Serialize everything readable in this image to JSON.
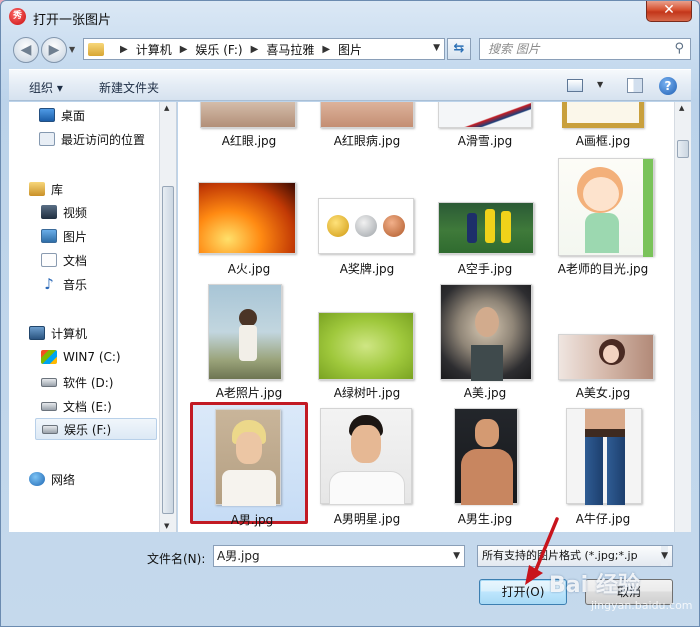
{
  "window": {
    "title": "打开一张图片",
    "app_icon_text": "秀",
    "close_label": "✕"
  },
  "nav": {
    "back_icon": "◀",
    "forward_icon": "▶",
    "breadcrumb": [
      "计算机",
      "娱乐 (F:)",
      "喜马拉雅",
      "图片"
    ],
    "refresh_icon": "⇆",
    "search_placeholder": "搜索 图片"
  },
  "toolbar": {
    "organize_label": "组织 ▾",
    "new_folder_label": "新建文件夹",
    "help_label": "?"
  },
  "sidebar": {
    "items": [
      {
        "label": "桌面",
        "icon": "desktop-icon"
      },
      {
        "label": "最近访问的位置",
        "icon": "recent-places-icon"
      },
      {
        "label": "库",
        "icon": "libraries-icon"
      },
      {
        "label": "视频",
        "icon": "video-icon"
      },
      {
        "label": "图片",
        "icon": "pictures-icon"
      },
      {
        "label": "文档",
        "icon": "documents-icon"
      },
      {
        "label": "音乐",
        "icon": "music-icon"
      },
      {
        "label": "计算机",
        "icon": "computer-icon"
      },
      {
        "label": "WIN7 (C:)",
        "icon": "windows-drive-icon"
      },
      {
        "label": "软件 (D:)",
        "icon": "drive-icon"
      },
      {
        "label": "文档 (E:)",
        "icon": "drive-icon"
      },
      {
        "label": "娱乐 (F:)",
        "icon": "drive-icon"
      },
      {
        "label": "网络",
        "icon": "network-icon"
      }
    ],
    "selected": "娱乐 (F:)"
  },
  "files": [
    {
      "name": "A红眼.jpg"
    },
    {
      "name": "A红眼病.jpg"
    },
    {
      "name": "A滑雪.jpg"
    },
    {
      "name": "A画框.jpg"
    },
    {
      "name": "A火.jpg"
    },
    {
      "name": "A奖牌.jpg"
    },
    {
      "name": "A空手.jpg"
    },
    {
      "name": "A老师的目光.jpg"
    },
    {
      "name": "A老照片.jpg"
    },
    {
      "name": "A绿树叶.jpg"
    },
    {
      "name": "A美.jpg"
    },
    {
      "name": "A美女.jpg"
    },
    {
      "name": "A男.jpg"
    },
    {
      "name": "A男明星.jpg"
    },
    {
      "name": "A男生.jpg"
    },
    {
      "name": "A牛仔.jpg"
    }
  ],
  "selected_file": "A男.jpg",
  "footer": {
    "filename_label": "文件名(N):",
    "filename_value": "A男.jpg",
    "filter_value": "所有支持的图片格式 (*.jpg;*.jp",
    "open_label": "打开(O)",
    "cancel_label": "取消"
  },
  "watermark": {
    "text": "Bai 经验",
    "sub": "jingyan.baidu.com"
  },
  "colors": {
    "selection_border": "#c21a24",
    "annotation_arrow": "#c8141c",
    "title_close": "#c3361a"
  }
}
